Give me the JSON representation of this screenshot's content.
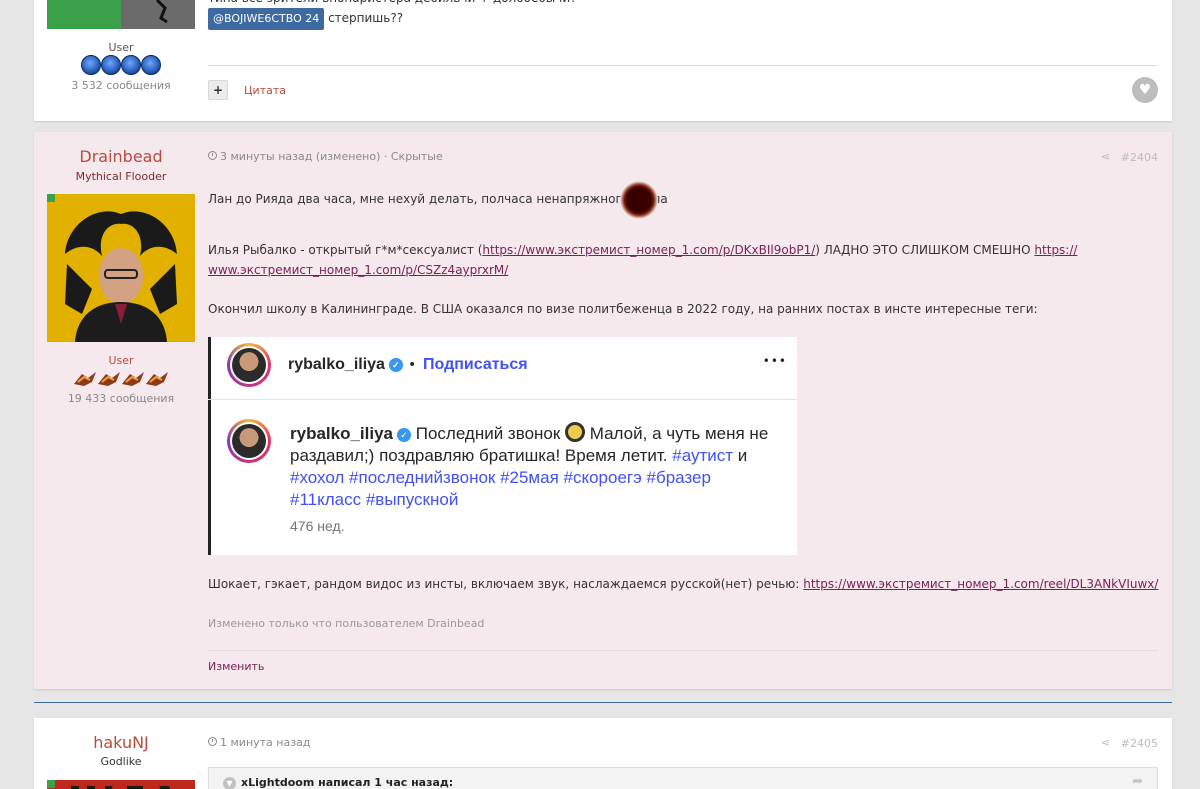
{
  "post_prev": {
    "snippet_top": "типа все зрители впопаристера дебильчи + долбоёбычи?",
    "mention": "@BOJIWE6CTBO 24",
    "mention_tail": "стерпишь??",
    "group": "User",
    "posts_count": "3 532 сообщения",
    "quote_label": "Цитата",
    "plus_label": "+",
    "like_icon": "heart-icon"
  },
  "post_2404": {
    "author": "Drainbead",
    "rank": "Mythical Flooder",
    "group": "User",
    "posts_count": "19 433 сообщения",
    "time": "3 минуты назад (изменено) · Скрытые",
    "number": "#2404",
    "line1": "Лан до Рияда два часа, мне нехуй делать, полчаса ненапряжного гугла",
    "line2_a": "Илья Рыбалко - открытый г*м*сексуалист (",
    "link1": "https://www.экстремист_номер_1.com/p/DKxBIl9obP1/",
    "line2_b": ") ЛАДНО ЭТО СЛИШКОМ СМЕШНО ",
    "link2a": "https://",
    "link2b": "www.экстремист_номер_1.com/p/CSZz4ayprxrM/",
    "line3": "Окончил школу в Калининграде. В США оказался по визе политбеженца в 2022 году, на ранних постах в инсте интересные теги:",
    "line4": "Шокает, гэкает, рандом видос из инсты, включаем звук, наслаждаемся русской(нет) речью: ",
    "link3": "https://www.экстремист_номер_1.com/reel/DL3ANkVIuwx/",
    "edited_note": "Изменено только что пользователем Drainbead",
    "edit_label": "Изменить",
    "embed": {
      "username": "rybalko_iliya",
      "dot": "•",
      "subscribe": "Подписаться",
      "more": "•••",
      "caption_user": "rybalko_iliya",
      "caption_1": " Последний звонок ",
      "caption_2": " Малой, а чуть меня не",
      "caption_3": "раздавил;) поздравляю братишка! Время летит. ",
      "tag1": "#аутист",
      "and": " и",
      "tags_line3": "#хохол #последнийзвонок #25мая #скороегэ #бразер",
      "tags_line4": "#11класс #выпускной",
      "weeks": "476 нед."
    }
  },
  "post_2405": {
    "author": "hakuNJ",
    "rank": "Godlike",
    "time": "1 минута назад",
    "number": "#2405",
    "quote_header": "xLightdoom написал 1 час назад:"
  }
}
